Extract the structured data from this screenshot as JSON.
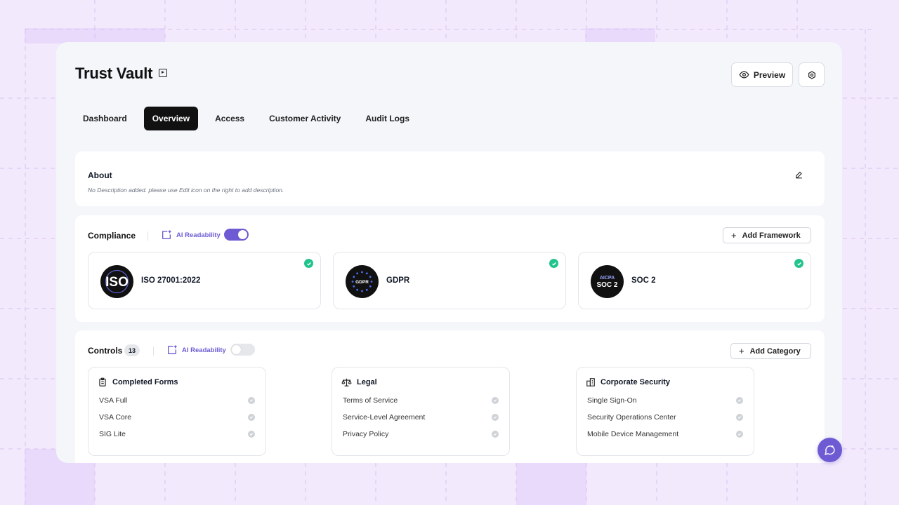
{
  "app": {
    "title": "Trust Vault"
  },
  "header": {
    "preview_label": "Preview"
  },
  "tabs": [
    {
      "label": "Dashboard",
      "active": false
    },
    {
      "label": "Overview",
      "active": true
    },
    {
      "label": "Access",
      "active": false
    },
    {
      "label": "Customer Activity",
      "active": false
    },
    {
      "label": "Audit Logs",
      "active": false
    }
  ],
  "about": {
    "title": "About",
    "description": "No Description added. please use Edit icon on the right to add description."
  },
  "compliance": {
    "title": "Compliance",
    "ai_readability_label": "AI Readability",
    "ai_readability_on": true,
    "add_button": "Add Framework",
    "frameworks": [
      {
        "name": "ISO 27001:2022",
        "logo_text": "ISO",
        "verified": true
      },
      {
        "name": "GDPR",
        "logo_text": "GDPR",
        "verified": true
      },
      {
        "name": "SOC 2",
        "logo_text": "SOC 2",
        "logo_top": "AICPA",
        "verified": true
      }
    ]
  },
  "controls": {
    "title": "Controls",
    "count": "13",
    "ai_readability_label": "AI Readability",
    "ai_readability_on": false,
    "add_button": "Add Category",
    "categories": [
      {
        "title": "Completed Forms",
        "icon": "clipboard-icon",
        "items": [
          "VSA Full",
          "VSA Core",
          "SIG Lite"
        ]
      },
      {
        "title": "Legal",
        "icon": "scale-icon",
        "items": [
          "Terms of Service",
          "Service-Level Agreement",
          "Privacy Policy"
        ]
      },
      {
        "title": "Corporate Security",
        "icon": "building-icon",
        "items": [
          "Single Sign-On",
          "Security Operations Center",
          "Mobile Device Management"
        ]
      }
    ]
  },
  "colors": {
    "accent": "#6e5bd3",
    "check": "#22c38e",
    "background": "#f3e9fc"
  }
}
